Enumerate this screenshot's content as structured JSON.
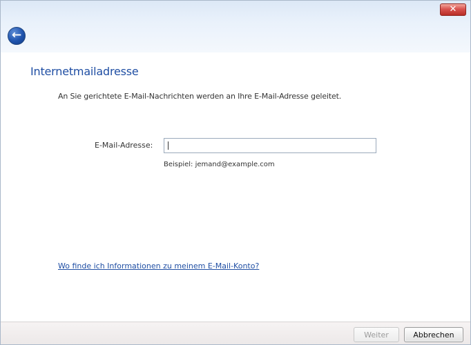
{
  "window": {
    "close_label": "✕",
    "back_icon": "back-arrow-icon"
  },
  "main": {
    "title": "Internetmailadresse",
    "intro": "An Sie gerichtete E-Mail-Nachrichten werden an Ihre E-Mail-Adresse geleitet.",
    "email_label": "E-Mail-Adresse:",
    "email_value": "",
    "example": "Beispiel: jemand@example.com",
    "help_link": "Wo finde ich Informationen zu meinem E-Mail-Konto?"
  },
  "footer": {
    "next_label": "Weiter",
    "cancel_label": "Abbrechen"
  },
  "colors": {
    "title": "#1f4ea3",
    "link": "#1f4ea3",
    "close_red": "#d9534f",
    "back_blue": "#1f53ad"
  }
}
